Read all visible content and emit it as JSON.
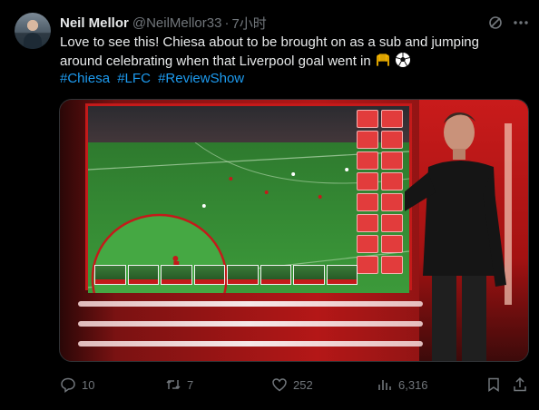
{
  "author": {
    "name": "Neil Mellor",
    "handle": "@NeilMellor33",
    "separator": "·",
    "time": "7小时"
  },
  "tweet": {
    "text_line1": "Love to see this! Chiesa about to be brought on as a sub and jumping",
    "text_line2": "around celebrating when that Liverpool goal went in",
    "hashtags": [
      "#Chiesa",
      "#LFC",
      "#ReviewShow"
    ]
  },
  "actions": {
    "reply": "10",
    "retweet": "7",
    "like": "252",
    "views": "6,316"
  },
  "colors": {
    "background": "#000000",
    "link": "#1d9bf0",
    "muted": "#71767b",
    "text": "#e7e9ea"
  },
  "icons": [
    "grok-icon",
    "more-icon",
    "raised-hands-emoji",
    "soccer-ball-emoji",
    "reply-icon",
    "retweet-icon",
    "like-icon",
    "views-icon",
    "bookmark-icon",
    "share-icon"
  ]
}
